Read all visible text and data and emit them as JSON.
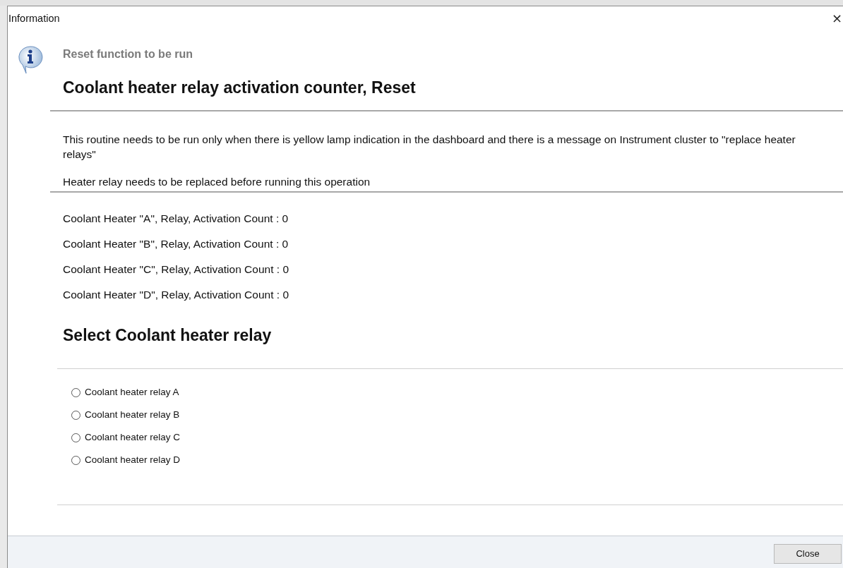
{
  "window": {
    "title": "Information",
    "close_glyph": "×"
  },
  "subtitle": "Reset function to be run",
  "heading": "Coolant heater relay activation counter, Reset",
  "description": "This routine needs to be run only when there is yellow lamp indication in the dashboard and there is a message on Instrument cluster to \"replace heater relays\"",
  "warning": "Heater relay needs to be replaced before running this operation",
  "counts": [
    "Coolant Heater \"A\", Relay, Activation Count : 0",
    "Coolant Heater \"B\", Relay, Activation Count : 0",
    "Coolant Heater \"C\", Relay, Activation Count : 0",
    "Coolant Heater \"D\", Relay, Activation Count : 0"
  ],
  "select_heading": "Select Coolant heater relay",
  "options": [
    {
      "label": "Coolant heater relay A",
      "selected": false
    },
    {
      "label": "Coolant heater relay B",
      "selected": false
    },
    {
      "label": "Coolant heater relay C",
      "selected": false
    },
    {
      "label": "Coolant heater relay D",
      "selected": false
    }
  ],
  "buttons": [
    "Close"
  ]
}
